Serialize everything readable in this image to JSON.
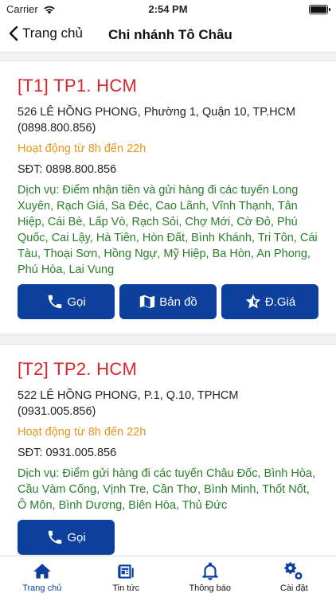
{
  "status": {
    "carrier": "Carrier",
    "time": "2:54 PM"
  },
  "nav": {
    "back_label": "Trang chủ",
    "title": "Chi nhánh Tô Châu"
  },
  "branches": [
    {
      "title": "[T1] TP1. HCM",
      "address": "526 LÊ HỒNG PHONG, Phường 1, Quận 10, TP.HCM (0898.800.856)",
      "hours": "Hoạt động từ 8h đến 22h",
      "phone": "SĐT: 0898.800.856",
      "service": "Dịch vụ: Điểm nhận tiền và gửi hàng đi các tuyến Long Xuyên, Rạch Giá, Sa Đéc, Cao Lãnh, Vĩnh Thạnh, Tân Hiệp, Cái Bè, Lấp Vò, Rạch Sỏi, Chợ Mới, Cờ Đỏ, Phú Quốc, Cai Lậy, Hà Tiên, Hòn Đất, Bình Khánh, Tri Tôn, Cái Tàu, Thoại Sơn, Hồng Ngự, Mỹ Hiệp, Ba Hòn, An Phong, Phú Hòa, Lai Vung",
      "buttons": {
        "call": "Gọi",
        "map": "Bản đồ",
        "rate": "Đ.Giá"
      }
    },
    {
      "title": "[T2] TP2. HCM",
      "address": "522 LÊ HỒNG PHONG, P.1, Q.10, TPHCM (0931.005.856)",
      "hours": "Hoạt động từ 8h đến 22h",
      "phone": "SĐT: 0931.005.856",
      "service": "Dịch vụ: Điểm gửi hàng đi các tuyến Châu Đốc, Bình Hòa, Cầu Vàm Cống, Vịnh Tre, Cần Thơ, Bình Minh, Thốt Nốt, Ô Môn, Bình Dương, Biên Hòa, Thủ Đức",
      "buttons": {
        "call": "Gọi"
      }
    }
  ],
  "tabs": [
    {
      "label": "Trang chủ",
      "icon": "home-icon"
    },
    {
      "label": "Tin tức",
      "icon": "news-icon"
    },
    {
      "label": "Thông báo",
      "icon": "bell-icon"
    },
    {
      "label": "Cài đặt",
      "icon": "gears-icon"
    }
  ],
  "colors": {
    "primary": "#0d3f9c",
    "title_red": "#d7262b",
    "hours_orange": "#e8961b",
    "service_green": "#2a7d2a"
  }
}
